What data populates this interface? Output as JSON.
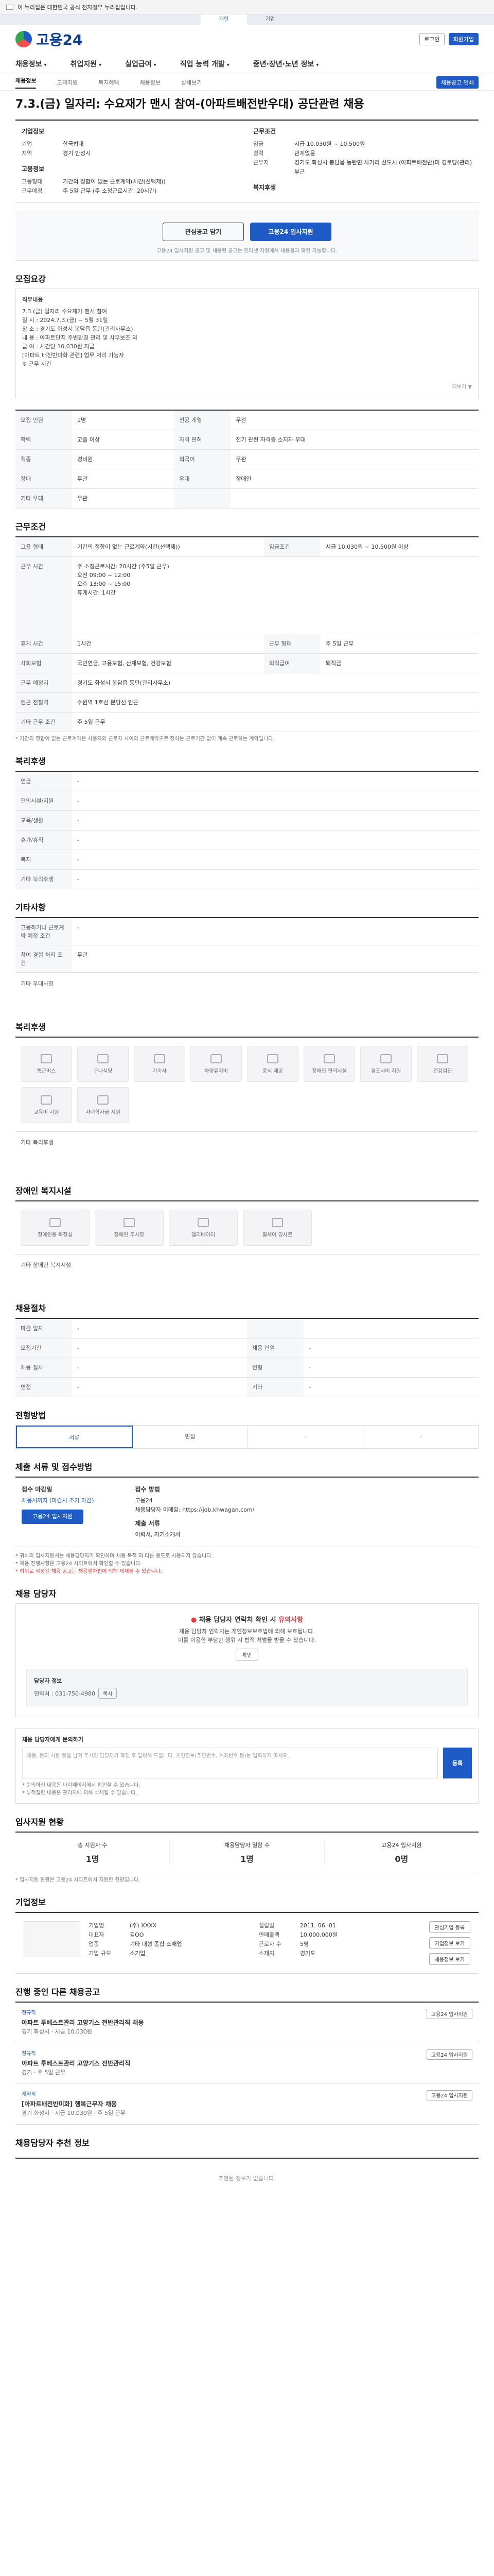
{
  "govbar": {
    "text": "이 누리집은 대한민국 공식 전자정부 누리집입니다."
  },
  "gov_tabs": [
    "개인",
    "기업"
  ],
  "header": {
    "logo_text": "고용24",
    "login": "로그인",
    "signup": "회원가입",
    "search": "검색"
  },
  "gnb": [
    "채용정보",
    "취업지원",
    "실업급여",
    "직업 능력 개발",
    "중년·장년·노년 정보",
    "고객지원"
  ],
  "subnav": [
    "채용정보",
    "고객지원",
    "복지혜택",
    "채용정보",
    "상세보기"
  ],
  "subnav_btn": "채용공고 인쇄",
  "title": "7.3.(금) 일자리: 수요재가 맨시 참여-(아파트배전반우대) 공단관련 채용",
  "summary": {
    "left_title": "기업정보",
    "left": [
      {
        "k": "기업",
        "v": "한국법대"
      },
      {
        "k": "지역",
        "v": "경기 안성시"
      }
    ],
    "left2_title": "고용정보",
    "left2": [
      {
        "k": "고용형태",
        "v": "기간의 정함이 없는 근로계약(시간(선택제))"
      },
      {
        "k": "근무예정",
        "v": "주 5일 근무 (주 소정근로시간: 20시간)"
      }
    ],
    "right_title": "근무조건",
    "right": [
      {
        "k": "임금",
        "v": "시급 10,030원 ~ 10,500원"
      },
      {
        "k": "경력",
        "v": "관계없음"
      },
      {
        "k": "근무지",
        "v": "경기도 화성시 봉담읍 동탄면 사거리 신도시 (아파트배전반)미 경로당(관리) 부근"
      }
    ],
    "welfare": "복지후생"
  },
  "apply": {
    "scrap": "관심공고 담기",
    "apply": "고용24 입사지원",
    "note": "고용24 입사지원 공고 및 채용된 공고는 인터넷 지원에서 채용결과 확인 가능합니다."
  },
  "recruit": {
    "title": "모집요강",
    "heading": "직무내용",
    "lines": [
      "7.3.(금) 일자리 수요재가 맨시 참여",
      "일 시 : 2024.7.3.(금) ~ 5월 31일",
      "장 소 : 경기도 화성시 봉담읍 동탄(관리사무소)",
      "내 용 : 아파트단지 주변환경 관리 및 사무보조 외",
      "급 여 : 시간당 10,030원 지급",
      "[아파트 배전반미화 관련] 업무 처리 가능자",
      "※ 근무 시간"
    ],
    "more": "더보기 ▼"
  },
  "cond_table": {
    "rows": [
      [
        {
          "k": "모집 인원",
          "v": "1명"
        },
        {
          "k": "전공 계열",
          "v": "무관"
        }
      ],
      [
        {
          "k": "학력",
          "v": "고졸 이상"
        },
        {
          "k": "자격 면허",
          "v": "전기 관련 자격증 소지자 우대"
        }
      ],
      [
        {
          "k": "직종",
          "v": "경비원"
        },
        {
          "k": "외국어",
          "v": "무관"
        }
      ],
      [
        {
          "k": "장애",
          "v": "무관"
        },
        {
          "k": "우대",
          "v": "장애인"
        }
      ],
      [
        {
          "k": "기타 우대",
          "v": "무관"
        },
        {
          "k": "",
          "v": ""
        }
      ]
    ]
  },
  "work_cond": {
    "title": "근무조건",
    "rows": [
      {
        "k": "고용 형태",
        "v": "기간의 정함이 없는 근로계약(시간(선택제))",
        "k2": "임금조건",
        "v2": "시급 10,030원 ~ 10,500원 이상"
      },
      {
        "k": "근무 시간",
        "v": "주 소정근로시간: 20시간 (주5일 근무)\n오전 09:00 ~ 12:00\n오후 13:00 ~ 15:00\n휴게시간: 1시간"
      },
      {
        "k": "휴게 시간",
        "v": "1시간",
        "k2": "근무 형태",
        "v2": "주 5일 근무"
      },
      {
        "k": "사회보험",
        "v": "국민연금, 고용보험, 산재보험, 건강보험",
        "k2": "퇴직급여",
        "v2": "퇴직금"
      },
      {
        "k": "근무 예정지",
        "v": "경기도 화성시 봉담읍 동탄(관리사무소)"
      },
      {
        "k": "인근 전철역",
        "v": "수원역 1호선 분당선 인근"
      },
      {
        "k": "기타 근무 조건",
        "v": "주 5일 근무"
      }
    ],
    "note": "* 기간의 정함이 없는 근로계약은 사용자와 근로자 사이의 근로계약으로 정하는 근로기간 없이 계속 근로하는 계약입니다."
  },
  "welfare": {
    "title": "복리후생",
    "rows": [
      {
        "k": "연금",
        "v": "-"
      },
      {
        "k": "편의시설/지원",
        "v": "-"
      },
      {
        "k": "교육/생활",
        "v": "-"
      },
      {
        "k": "휴가/휴직",
        "v": "-"
      },
      {
        "k": "복지",
        "v": "-"
      },
      {
        "k": "기타 복리후생",
        "v": "-"
      }
    ]
  },
  "etc": {
    "title": "기타사항",
    "rows": [
      {
        "k": "고용하거나 근로계약 예정 조건",
        "v": "-"
      },
      {
        "k": "참여 경험 처리 조건",
        "v": "무관"
      }
    ],
    "extra": "기타 우대사항"
  },
  "facilities": {
    "title": "복리후생",
    "cards": [
      "통근버스",
      "구내식당",
      "기숙사",
      "차량유지비",
      "중식 제공",
      "장애인 편의시설",
      "경조사비 지원",
      "건강검진",
      "교육비 지원",
      "자녀학자금 지원"
    ],
    "etc": "기타 복리후생"
  },
  "disabled": {
    "title": "장애인 복지시설",
    "cards": [
      "장애인용 화장실",
      "장애인 주차장",
      "엘리베이터",
      "휠체어 경사로"
    ],
    "etc": "기타 장애인 복지시설"
  },
  "hiring": {
    "title": "채용절차",
    "rows": [
      [
        {
          "k": "마감 일자",
          "v": "-"
        },
        {
          "k": "",
          "v": ""
        }
      ],
      [
        {
          "k": "모집기간",
          "v": "-"
        },
        {
          "k": "채용 인원",
          "v": "-"
        }
      ],
      [
        {
          "k": "채용 절차",
          "v": "-"
        },
        {
          "k": "전형",
          "v": "-"
        }
      ],
      [
        {
          "k": "면접",
          "v": "-"
        },
        {
          "k": "기타",
          "v": "-"
        }
      ]
    ]
  },
  "steps": {
    "title": "전형방법",
    "items": [
      "서류",
      "면접",
      "-",
      "-"
    ]
  },
  "method": {
    "title": "제출 서류 및 접수방법",
    "left_h": "접수 마감일",
    "left_v": "채용시까지 (마감시 조기 마감)",
    "apply": "고용24 입사지원",
    "right_h": "접수 방법",
    "right_lines": [
      "고용24",
      "채용담당자 이메일: https://job.khwagan.com/"
    ],
    "right_h2": "제출 서류",
    "right_v2": "이력서, 자기소개서"
  },
  "notice": [
    "* 귀하의 입사지원서는 채용담당자가 확인하며 채용 목적 외 다른 용도로 사용되지 않습니다.",
    "* 채용 진행사항은 고용24 사이트에서 확인할 수 있습니다.",
    "* 허위로 작성된 채용 공고는 채용절차법에 의해 제재될 수 있습니다."
  ],
  "report": {
    "title": "채용 담당자",
    "warn_pre": "채용 담당자 연락처 확인 시 ",
    "warn_red": "유의사항",
    "lines": [
      "채용 담당자 연락처는 개인정보보호법에 의해 보호됩니다.",
      "이를 이용한 부당한 행위 시 법적 처벌을 받을 수 있습니다."
    ],
    "btn": "확인",
    "r1": "담당자 정보",
    "r2_label": "연락처",
    "r2_value": "031-750-4980",
    "r2_btn": "복사"
  },
  "qa": {
    "title": "채용 담당자에게 문의하기",
    "placeholder": "채용, 문의 사항 등을 남겨 주시면 담당자가 확인 후 답변해 드립니다. 개인정보(주민번호, 계좌번호 등)는 입력하지 마세요.",
    "btn": "등록",
    "note1": "* 문의하신 내용은 마이페이지에서 확인할 수 있습니다.",
    "note2": "* 부적절한 내용은 관리자에 의해 삭제될 수 있습니다."
  },
  "stats": {
    "title": "입사지원 현황",
    "items": [
      {
        "k": "총 지원자 수",
        "v": "1명"
      },
      {
        "k": "채용담당자 열람 수",
        "v": "1명"
      },
      {
        "k": "고용24 입사지원",
        "v": "0명"
      }
    ],
    "note": "* 입사지원 현황은 고용24 사이트에서 지원한 현황입니다."
  },
  "company": {
    "title": "기업정보",
    "rows": [
      {
        "k": "기업명",
        "v": "(주) XXXX"
      },
      {
        "k": "대표자",
        "v": "김OO"
      },
      {
        "k": "업종",
        "v": "기타 대형 종합 소매업"
      },
      {
        "k": "기업 규모",
        "v": "소기업"
      },
      {
        "k": "설립일",
        "v": "2011. 06. 01"
      },
      {
        "k": "연매출액",
        "v": "10,000,000원"
      },
      {
        "k": "근로자 수",
        "v": "5명"
      },
      {
        "k": "소재지",
        "v": "경기도"
      }
    ],
    "btns": [
      "관심기업 등록",
      "기업정보 보기",
      "채용정보 보기"
    ]
  },
  "other_jobs": {
    "title": "진행 중인 다른 채용공고",
    "items": [
      {
        "tag": "정규직",
        "name": "아파트 투베스트관리 고양기스 전반관리직 채용",
        "meta": "경기 화성시 · 시급 10,030원",
        "right": "고용24 입사지원"
      },
      {
        "tag": "정규직",
        "name": "아파트 투베스트관리 고양기스 전반관리직",
        "meta": "경기 · 주 5일 근무",
        "right": "고용24 입사지원"
      },
      {
        "tag": "계약직",
        "name": "[아파트배전반미화] 행복근무자 채용",
        "meta": "경기 화성시 · 시급 10,030원 · 주 5일 근무",
        "right": "고용24 입사지원"
      }
    ]
  },
  "recommend": {
    "title": "채용담당자 추천 정보",
    "empty": "추천된 정보가 없습니다."
  }
}
